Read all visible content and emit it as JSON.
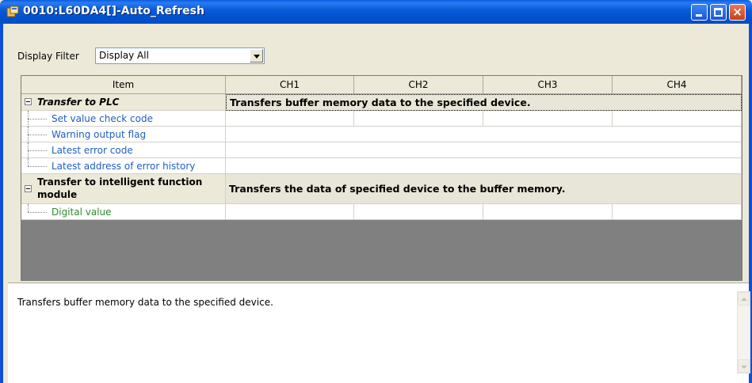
{
  "window": {
    "title": "0010:L60DA4[]-Auto_Refresh",
    "controls": {
      "minimize": "minimize",
      "maximize": "maximize",
      "close": "×"
    }
  },
  "filter": {
    "label": "Display Filter",
    "value": "Display All"
  },
  "grid": {
    "columns": [
      "Item",
      "CH1",
      "CH2",
      "CH3",
      "CH4"
    ],
    "categories": [
      {
        "label": "Transfer to PLC",
        "description": "Transfers buffer memory data to the specified device.",
        "items": [
          "Set value check code",
          "Warning output flag",
          "Latest error code",
          "Latest address of error history"
        ]
      },
      {
        "label": "Transfer to intelligent function module",
        "label_line1": "Transfer to intelligent function",
        "label_line2": "module",
        "description": "Transfers the data of specified device to the buffer memory.",
        "items": [
          "Digital value"
        ]
      }
    ]
  },
  "description_pane": {
    "text": "Transfers buffer memory data to the specified device."
  },
  "colors": {
    "titlebar": "#0053d0",
    "item_text": "#1f5fbf",
    "digital_value_text": "#2f8a2f",
    "grid_empty_area": "#808080"
  }
}
